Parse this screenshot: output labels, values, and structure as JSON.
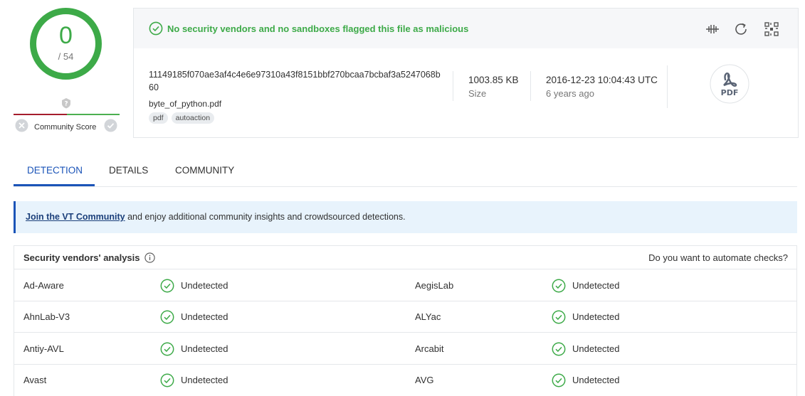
{
  "score": {
    "value": "0",
    "total": "/ 54",
    "community_label": "Community Score"
  },
  "status": {
    "message": "No security vendors and no sandboxes flagged this file as malicious"
  },
  "file": {
    "hash": "11149185f070ae3af4c4e6e97310a43f8151bbf270bcaa7bcbaf3a5247068b60",
    "name": "byte_of_python.pdf",
    "tags": [
      "pdf",
      "autoaction"
    ],
    "size_value": "1003.85 KB",
    "size_label": "Size",
    "date_value": "2016-12-23 10:04:43 UTC",
    "date_label": "6 years ago",
    "type_icon_text": "PDF"
  },
  "tabs": [
    "DETECTION",
    "DETAILS",
    "COMMUNITY"
  ],
  "banner": {
    "link_text": "Join the VT Community",
    "rest_text": " and enjoy additional community insights and crowdsourced detections."
  },
  "analysis": {
    "title": "Security vendors' analysis",
    "automate_text": "Do you want to automate checks?",
    "rows": [
      {
        "left_vendor": "Ad-Aware",
        "left_result": "Undetected",
        "right_vendor": "AegisLab",
        "right_result": "Undetected"
      },
      {
        "left_vendor": "AhnLab-V3",
        "left_result": "Undetected",
        "right_vendor": "ALYac",
        "right_result": "Undetected"
      },
      {
        "left_vendor": "Antiy-AVL",
        "left_result": "Undetected",
        "right_vendor": "Arcabit",
        "right_result": "Undetected"
      },
      {
        "left_vendor": "Avast",
        "left_result": "Undetected",
        "right_vendor": "AVG",
        "right_result": "Undetected"
      }
    ]
  },
  "colors": {
    "accent": "#1b54b8",
    "good": "#3daa48",
    "bad": "#a51d2d",
    "muted": "#777777"
  },
  "icons": [
    "check-circle-icon",
    "question-icon",
    "close-circle-icon",
    "compare-icon",
    "reanalyze-icon",
    "qr-icon",
    "pdf-file-icon",
    "info-icon"
  ]
}
